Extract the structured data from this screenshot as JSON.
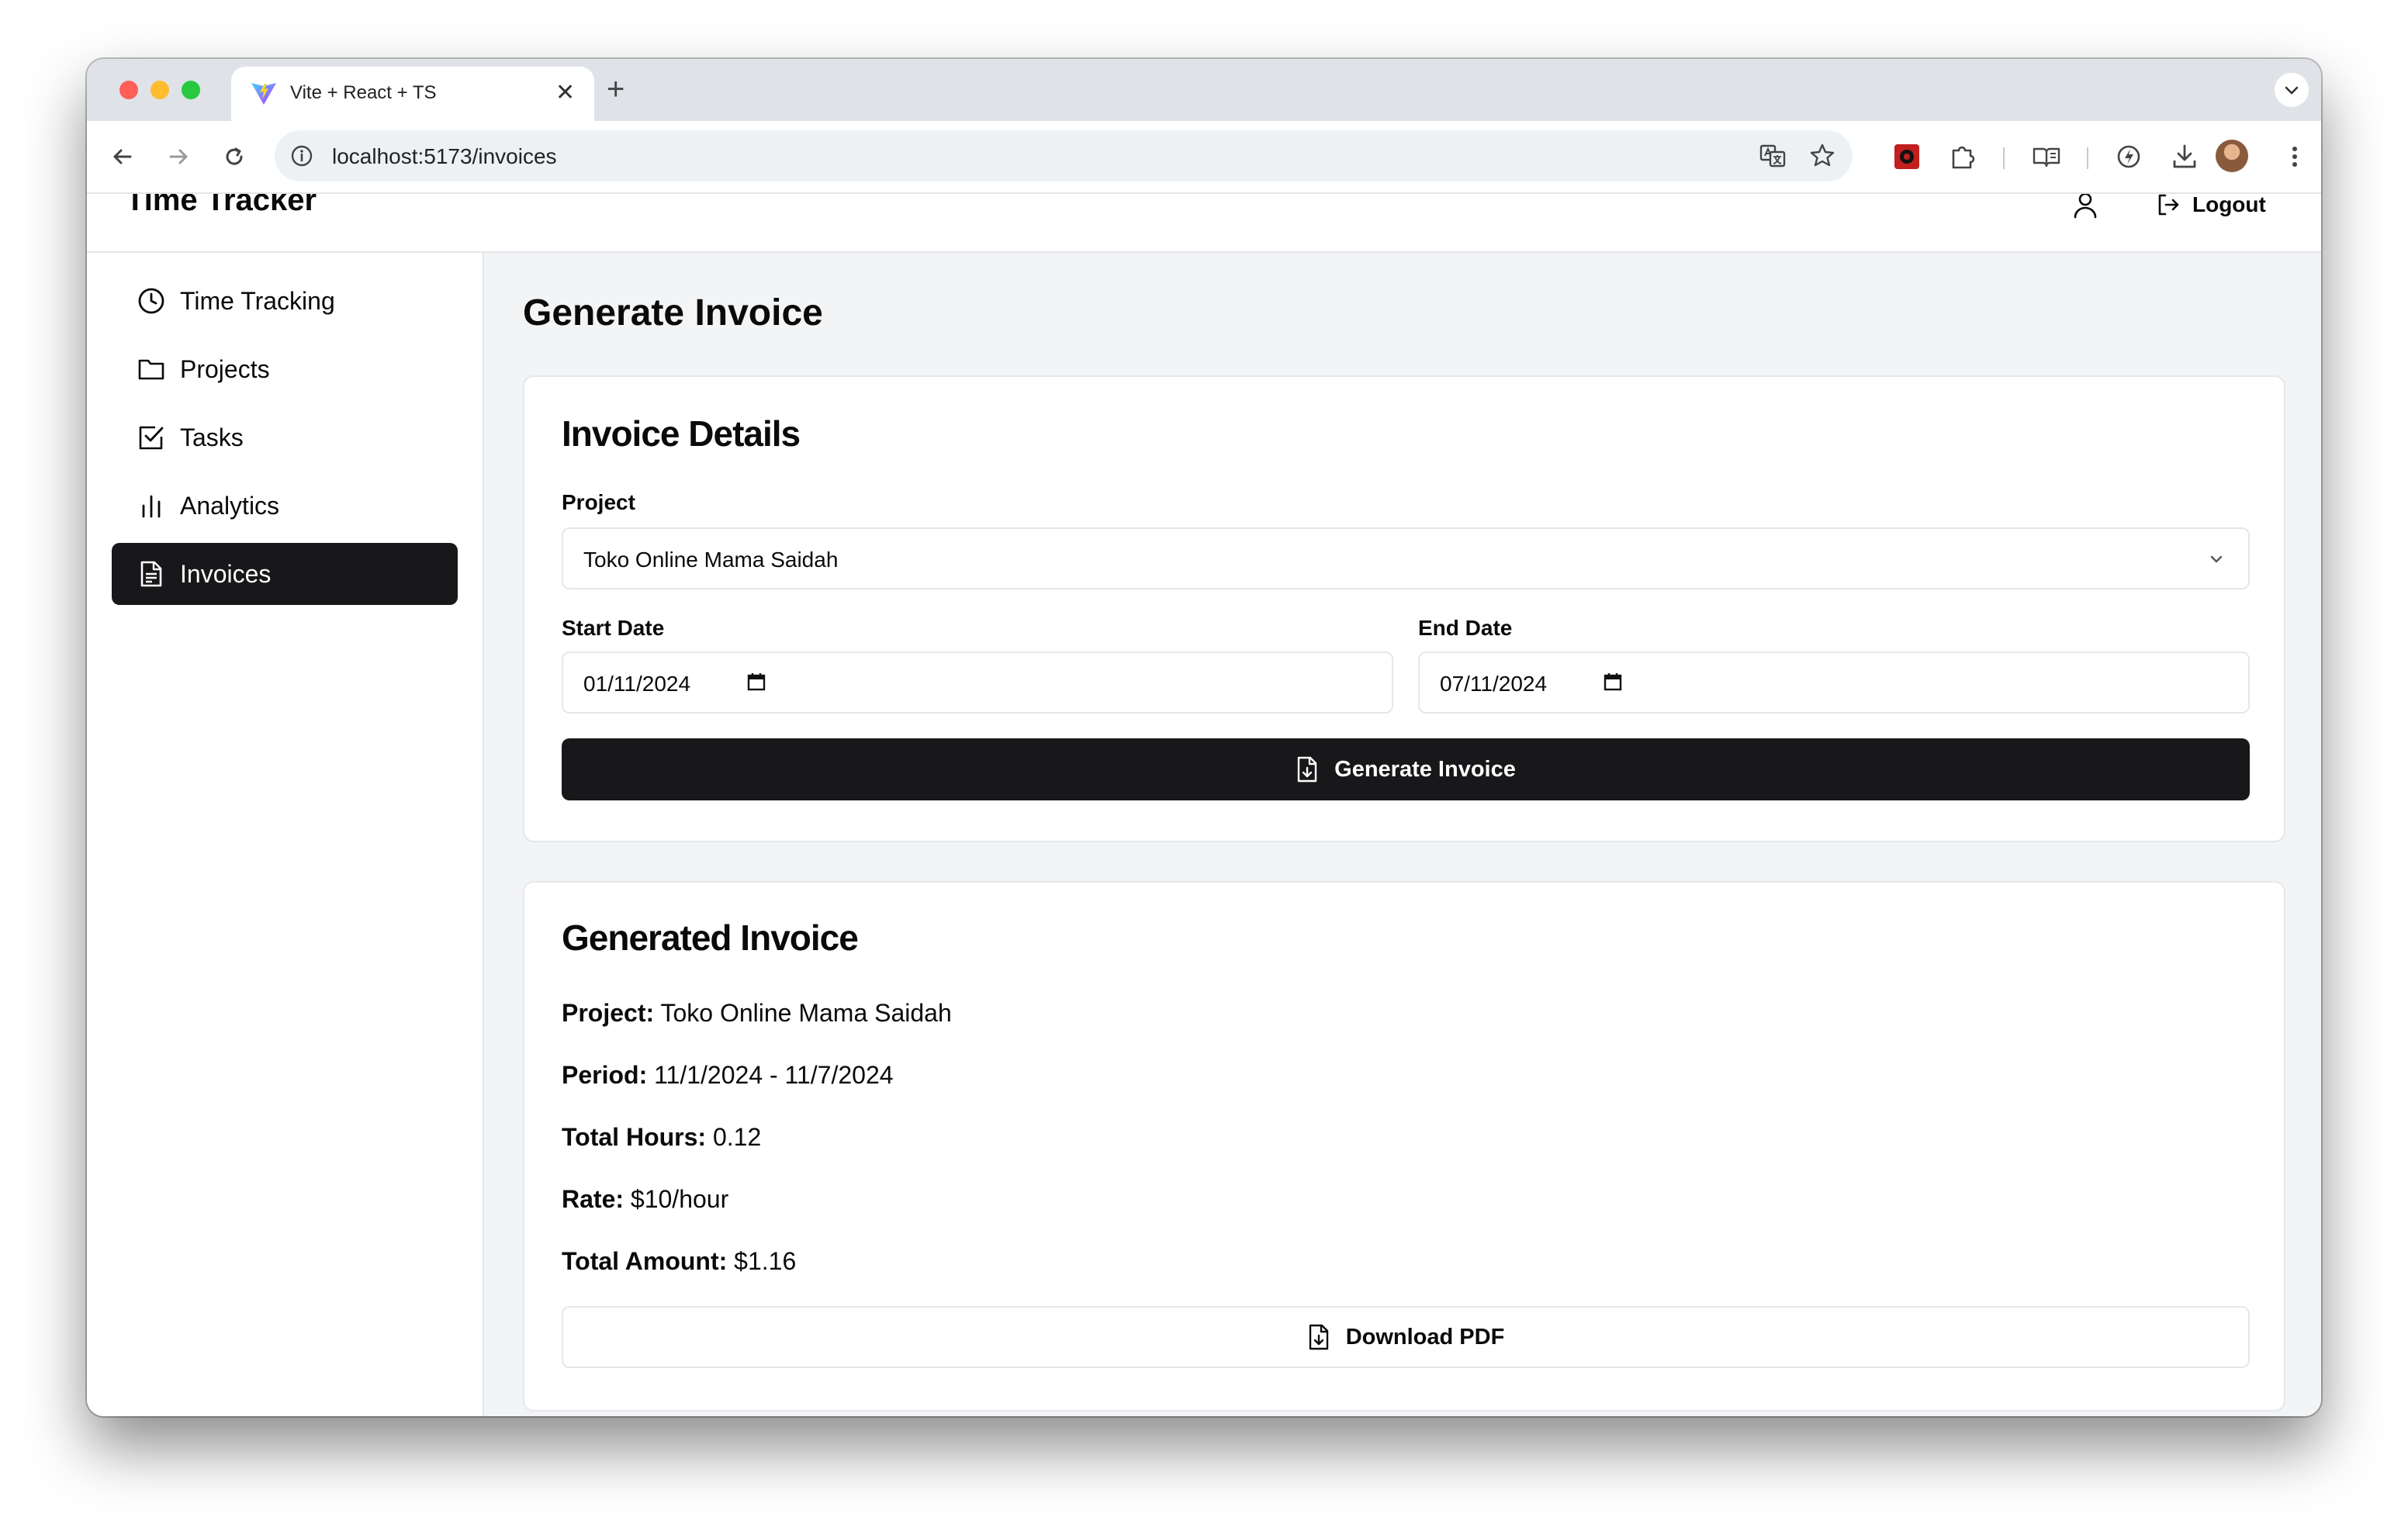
{
  "browser": {
    "tab_title": "Vite + React + TS",
    "tab_close": "✕",
    "new_tab": "+",
    "url": "localhost:5173/invoices"
  },
  "app": {
    "brand": "Time Tracker",
    "logout_label": "Logout"
  },
  "sidebar": {
    "items": [
      {
        "label": "Time Tracking",
        "icon": "clock-icon"
      },
      {
        "label": "Projects",
        "icon": "folder-icon"
      },
      {
        "label": "Tasks",
        "icon": "checkbox-icon"
      },
      {
        "label": "Analytics",
        "icon": "bar-chart-icon"
      },
      {
        "label": "Invoices",
        "icon": "file-text-icon",
        "active": true
      }
    ]
  },
  "page": {
    "title": "Generate Invoice"
  },
  "details_card": {
    "title": "Invoice Details",
    "project_label": "Project",
    "project_value": "Toko Online Mama Saidah",
    "start_label": "Start Date",
    "start_value": "01/11/2024",
    "end_label": "End Date",
    "end_value": "07/11/2024",
    "generate_label": "Generate Invoice"
  },
  "result_card": {
    "title": "Generated Invoice",
    "project_key": "Project:",
    "project_val": "Toko Online Mama Saidah",
    "period_key": "Period:",
    "period_val": "11/1/2024 - 11/7/2024",
    "hours_key": "Total Hours:",
    "hours_val": "0.12",
    "rate_key": "Rate:",
    "rate_val": "$10/hour",
    "amount_key": "Total Amount:",
    "amount_val": "$1.16",
    "download_label": "Download PDF"
  },
  "colors": {
    "primary": "#18181b",
    "background": "#f3f4f6",
    "border": "#e5e7eb"
  }
}
